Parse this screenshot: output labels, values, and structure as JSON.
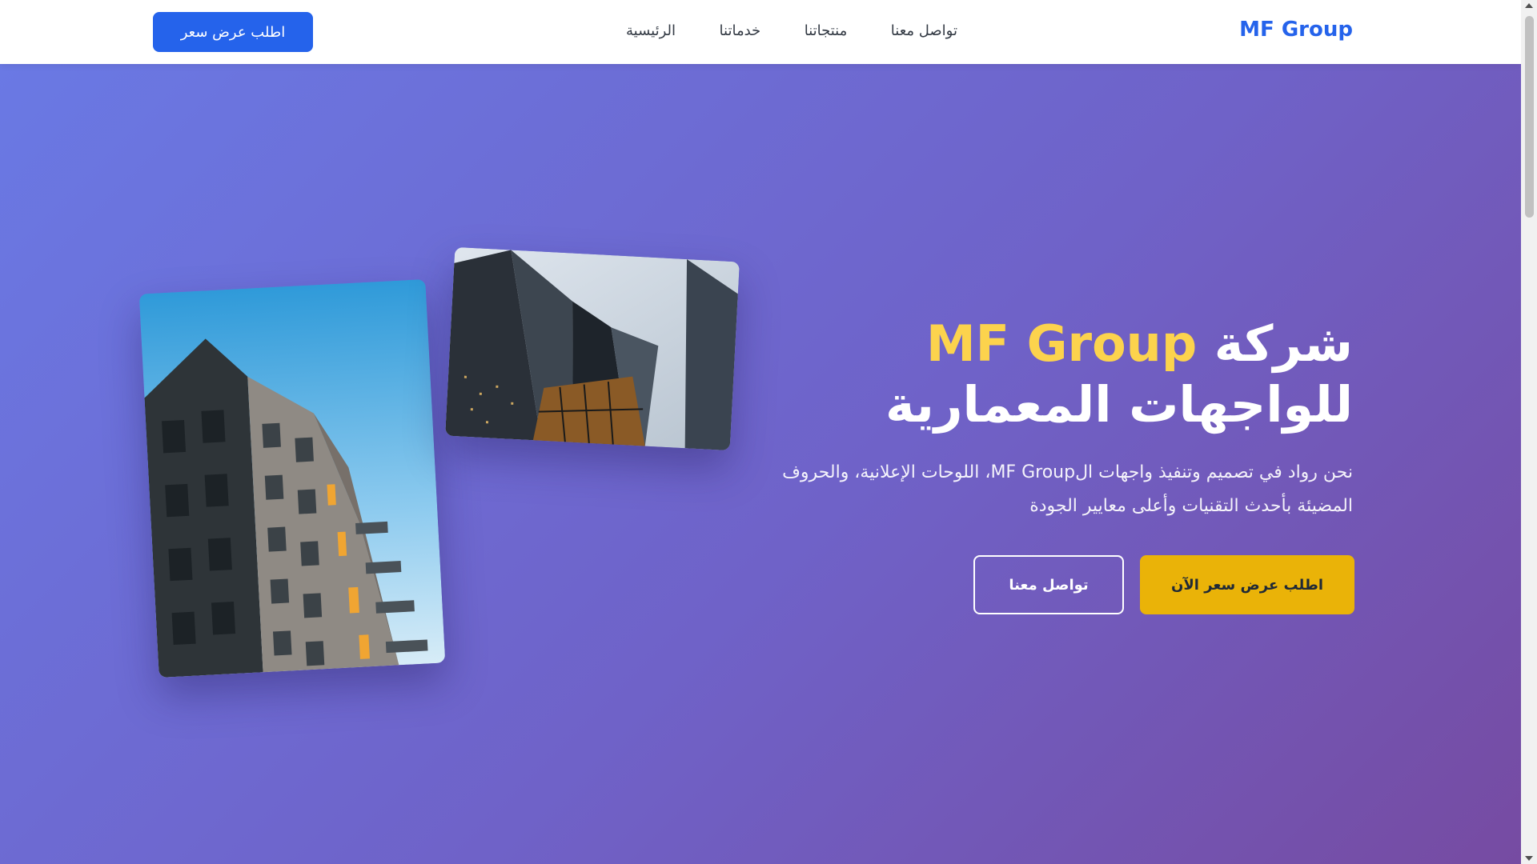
{
  "header": {
    "logo": "MF Group",
    "nav": [
      "الرئيسية",
      "خدماتنا",
      "منتجاتنا",
      "تواصل معنا"
    ],
    "cta_label": "اطلب عرض سعر"
  },
  "hero": {
    "title_prefix": "شركة",
    "title_brand": "MF Group",
    "title_line2": "للواجهات المعمارية",
    "subtitle": "نحن رواد في تصميم وتنفيذ واجهات الMF Group، اللوحات الإعلانية، والحروف المضيئة بأحدث التقنيات وأعلى معايير الجودة",
    "primary_button": "اطلب عرض سعر الآن",
    "secondary_button": "تواصل معنا"
  },
  "images": [
    {
      "name": "residential-building-photo"
    },
    {
      "name": "skyscrapers-photo"
    }
  ],
  "colors": {
    "brand_blue": "#2563eb",
    "accent_yellow": "#eab308",
    "title_highlight": "#fcd34d",
    "hero_gradient_start": "#6a79e4",
    "hero_gradient_end": "#764ba2"
  }
}
